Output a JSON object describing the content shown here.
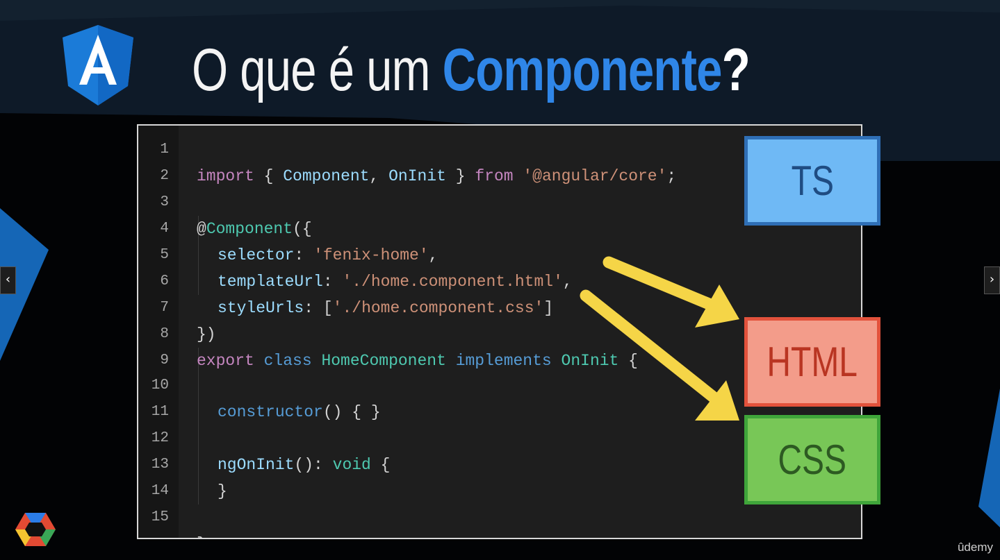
{
  "slide": {
    "title_light": "O que é um",
    "title_accent": "Componente",
    "title_end": "?",
    "logo_letter": "A"
  },
  "code": {
    "lines": [
      {
        "num": "1"
      },
      {
        "num": "2"
      },
      {
        "num": "3"
      },
      {
        "num": "4"
      },
      {
        "num": "5"
      },
      {
        "num": "6"
      },
      {
        "num": "7"
      },
      {
        "num": "8"
      },
      {
        "num": "9"
      },
      {
        "num": "10"
      },
      {
        "num": "11"
      },
      {
        "num": "12"
      },
      {
        "num": "13"
      },
      {
        "num": "14"
      },
      {
        "num": "15"
      }
    ],
    "tokens": {
      "import": "import",
      "open_brace": " { ",
      "component": "Component",
      "comma": ", ",
      "oninit": "OnInit",
      "close_brace": " } ",
      "from": "from",
      "module": " '@angular/core'",
      "semi": ";",
      "at": "@",
      "decorator": "Component",
      "paren_open": "({",
      "selector_key": "selector",
      "colon": ": ",
      "selector_val": "'fenix-home'",
      "comma_end": ",",
      "template_key": "templateUrl",
      "template_val": "'./home.component.html'",
      "styles_key": "styleUrls",
      "styles_open": "[",
      "styles_val": "'./home.component.css'",
      "styles_close": "]",
      "decorator_close": "})",
      "export": "export",
      "class": " class ",
      "class_name": "HomeComponent",
      "implements": " implements ",
      "iface": "OnInit",
      "brace_open": " {",
      "constructor": "constructor",
      "ctor_rest": "() { }",
      "ngoninit": "ngOnInit",
      "ngo_rest": "(): ",
      "void": "void",
      "brace_open2": " {",
      "brace_close": "}",
      "brace_close_final": "}"
    }
  },
  "boxes": {
    "ts": "TS",
    "html": "HTML",
    "css": "CSS"
  },
  "colors": {
    "accent": "#2f86e8",
    "ts_fill": "#6fb9f5",
    "html_fill": "#f39c8a",
    "css_fill": "#78c757",
    "arrow": "#f5d547"
  },
  "navigation": {
    "prev": "‹",
    "next": "›"
  },
  "watermark": "ûdemy"
}
